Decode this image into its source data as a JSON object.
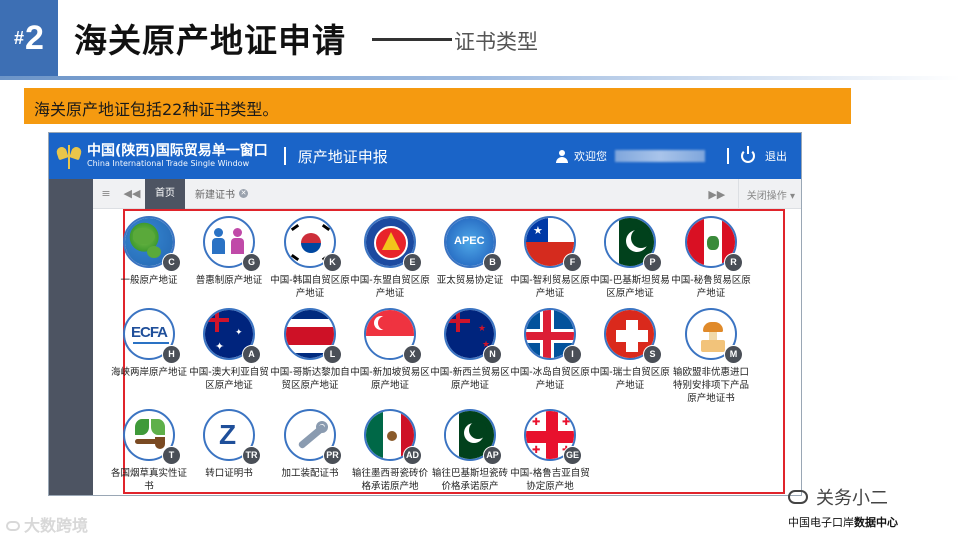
{
  "slide": {
    "number_hash": "#",
    "number": "2",
    "title": "海关原产地证申请",
    "subtitle": "证书类型",
    "banner": "海关原产地证包括22种证书类型。"
  },
  "app": {
    "brand_cn": "中国(陕西)国际贸易单一窗口",
    "brand_en": "China International Trade Single Window",
    "title": "原产地证申报",
    "welcome": "欢迎您",
    "logout": "退出"
  },
  "tabs": {
    "menu_glyph": "≡",
    "prev_glyph": "◀◀",
    "home": "首页",
    "new_cert": "新建证书",
    "close_glyph": "✕",
    "next_glyph": "▶▶",
    "close_ops": "关闭操作 ▾"
  },
  "certificates": [
    {
      "label": "一般原产地证",
      "badge": "C",
      "icon": "globe-icon"
    },
    {
      "label": "普惠制原产地证",
      "badge": "G",
      "icon": "people-icon"
    },
    {
      "label": "中国-韩国自贸区原产地证",
      "badge": "K",
      "icon": "korea-flag-icon"
    },
    {
      "label": "中国-东盟自贸区原产地证",
      "badge": "E",
      "icon": "asean-icon"
    },
    {
      "label": "亚太贸易协定证",
      "badge": "B",
      "icon": "apec-icon"
    },
    {
      "label": "中国-智利贸易区原产地证",
      "badge": "F",
      "icon": "chile-flag-icon"
    },
    {
      "label": "中国-巴基斯坦贸易区原产地证",
      "badge": "P",
      "icon": "pakistan-flag-icon"
    },
    {
      "label": "中国-秘鲁贸易区原产地证",
      "badge": "R",
      "icon": "peru-flag-icon"
    },
    {
      "label": "海峡两岸原产地证",
      "badge": "H",
      "icon": "ecfa-icon"
    },
    {
      "label": "中国-澳大利亚自贸区原产地证",
      "badge": "A",
      "icon": "australia-flag-icon"
    },
    {
      "label": "中国-哥斯达黎加自贸区原产地证",
      "badge": "L",
      "icon": "costa-rica-flag-icon"
    },
    {
      "label": "中国-新加坡贸易区原产地证",
      "badge": "X",
      "icon": "singapore-flag-icon"
    },
    {
      "label": "中国-新西兰贸易区原产地证",
      "badge": "N",
      "icon": "new-zealand-flag-icon"
    },
    {
      "label": "中国-冰岛自贸区原产地证",
      "badge": "I",
      "icon": "iceland-flag-icon"
    },
    {
      "label": "中国-瑞士自贸区原产地证",
      "badge": "S",
      "icon": "switzerland-flag-icon"
    },
    {
      "label": "输欧盟非优惠进口特别安排项下产品原产地证书",
      "badge": "M",
      "icon": "mushroom-jar-icon"
    },
    {
      "label": "各国烟草真实性证书",
      "badge": "T",
      "icon": "pipe-icon"
    },
    {
      "label": "转口证明书",
      "badge": "TR",
      "icon": "z-transit-icon"
    },
    {
      "label": "加工装配证书",
      "badge": "PR",
      "icon": "wrench-icon"
    },
    {
      "label": "输往墨西哥瓷砖价格承诺原产地",
      "badge": "AD",
      "icon": "mexico-tile-icon"
    },
    {
      "label": "输往巴基斯坦瓷砖价格承诺原产",
      "badge": "AP",
      "icon": "pakistan-tile-icon"
    },
    {
      "label": "中国-格鲁吉亚自贸协定原产地",
      "badge": "GE",
      "icon": "georgia-flag-icon"
    }
  ],
  "watermarks": {
    "left": "大数跨境",
    "right_title": "关务小二",
    "right_sub_a": "中国电子口岸",
    "right_sub_b": "数据中心"
  }
}
